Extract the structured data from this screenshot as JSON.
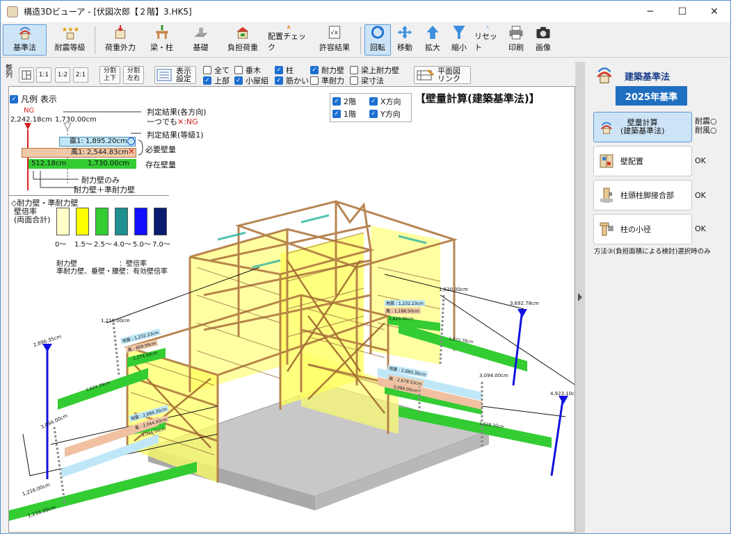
{
  "window": {
    "title": "構造3Dビューア - [伏図次郎【２階】3.HK5]"
  },
  "toolbar": {
    "items": [
      {
        "label": "基準法",
        "icon": "kijunho-icon",
        "active": true
      },
      {
        "label": "耐震等級",
        "icon": "stars-icon"
      },
      {
        "label": "荷重外力",
        "icon": "load-icon"
      },
      {
        "label": "梁・柱",
        "icon": "beam-column-icon"
      },
      {
        "label": "基礎",
        "icon": "foundation-icon"
      },
      {
        "label": "負担荷重",
        "icon": "burden-load-icon"
      },
      {
        "label": "配置チェック",
        "icon": "warning-icon"
      },
      {
        "label": "許容結果",
        "icon": "allowable-result-icon"
      },
      {
        "label": "回転",
        "icon": "rotate-icon",
        "active": true
      },
      {
        "label": "移動",
        "icon": "move-icon"
      },
      {
        "label": "拡大",
        "icon": "zoom-in-icon"
      },
      {
        "label": "縮小",
        "icon": "zoom-out-icon"
      },
      {
        "label": "リセット",
        "icon": "reset-icon"
      },
      {
        "label": "印刷",
        "icon": "print-icon"
      },
      {
        "label": "画像",
        "icon": "camera-icon"
      }
    ]
  },
  "options": {
    "seiretsu": "整列",
    "ratio_1_1": "1:1",
    "ratio_1_2": "1:2",
    "ratio_2_1": "2:1",
    "split_ud": "分割\n上下",
    "split_lr": "分割\n左右",
    "display_settings": "表示\n設定",
    "plan_link": "平面図\nリンク",
    "checks": [
      {
        "label": "全て",
        "checked": false
      },
      {
        "label": "上部",
        "checked": true
      },
      {
        "label": "垂木",
        "checked": false
      },
      {
        "label": "小屋組",
        "checked": true
      },
      {
        "label": "柱",
        "checked": true
      },
      {
        "label": "筋かい",
        "checked": true
      },
      {
        "label": "耐力壁",
        "checked": true
      },
      {
        "label": "準耐力",
        "checked": false
      },
      {
        "label": "梁上耐力壁",
        "checked": false
      },
      {
        "label": "梁寸法",
        "checked": false
      }
    ]
  },
  "view": {
    "legend_checkbox": "凡例 表示",
    "heading": "【壁量計算(建築基準法)】",
    "floors": [
      {
        "label": "2階",
        "checked": true
      },
      {
        "label": "1階",
        "checked": true
      }
    ],
    "directions": [
      {
        "label": "X方向",
        "checked": true
      },
      {
        "label": "Y方向",
        "checked": true
      }
    ],
    "legend": {
      "ng_label": "NG",
      "req_value_left": "2,242.18cm",
      "req_value_right": "1,730.00cm",
      "judge_all": "判定結果(各方向)",
      "judge_all_note": "一つでも",
      "judge_all_mark": "✕:NG",
      "judge_grade": "判定結果(等級1)",
      "quake_bar": "震1: 1,895.20cm",
      "wind_bar": "風1: 2,544.83cm",
      "existing_left": "512.18cm",
      "existing_right": "1,730.00cm",
      "required_wall": "必要壁量",
      "existing_wall": "存在壁量",
      "bearing_only": "耐力壁のみ",
      "bearing_plus": "耐力壁＋準耐力壁",
      "section_title": "◇耐力壁・準耐力壁",
      "ratio_title": "壁倍率\n(両面合計)",
      "swatches": [
        {
          "color": "#ffffc8",
          "label": "0〜"
        },
        {
          "color": "#ffff00",
          "label": "1.5〜"
        },
        {
          "color": "#33cc33",
          "label": "2.5〜"
        },
        {
          "color": "#1f8f8f",
          "label": "4.0〜"
        },
        {
          "color": "#1010ff",
          "label": "5.0〜"
        },
        {
          "color": "#0a1a6e",
          "label": "7.0〜"
        }
      ],
      "note1": "耐力壁　　　　　　：壁倍率",
      "note2": "準耐力壁、垂壁・腰壁：有効壁倍率"
    },
    "dims": [
      "2,896.35cm",
      "1,216.00cm",
      "3,094.00cm",
      "1,216.00cm",
      "1,620.00cm",
      "3,692.78cm",
      "3,094.00cm",
      "4,923.10cm"
    ],
    "bars": [
      {
        "label": "地震 : 1,232.23cm",
        "mark": "circle"
      },
      {
        "label": "風 : 1,188.50cm",
        "mark": "circle"
      },
      {
        "label": "1,620.00cm"
      },
      {
        "label": "1,672.78cm"
      },
      {
        "label": "地震 : 1,232.23cm",
        "mark": "circle"
      },
      {
        "label": "風 : 809.99cm",
        "mark": "circle"
      },
      {
        "label": "1,274.00cm"
      },
      {
        "label": "1,624.39cm"
      },
      {
        "label": "地震 : 2,880.30cm",
        "mark": "circle"
      },
      {
        "label": "風 : 2,678.53cm",
        "mark": "circle"
      },
      {
        "label": "3,094.00cm"
      },
      {
        "label": "1,628.10cm"
      },
      {
        "label": "地震 : 2,886.35cm",
        "mark": "circle"
      },
      {
        "label": "風 : 2,044.00cm",
        "mark": "circle"
      },
      {
        "label": "3,094.00cm"
      },
      {
        "label": "1,216.00cm"
      }
    ]
  },
  "sidebar": {
    "title": "建築基準法",
    "badge": "2025年基準",
    "items": [
      {
        "label": "壁量計算\n(建築基準法)",
        "status": "耐震○\n耐風○",
        "active": true,
        "icon": "wall-calc-icon"
      },
      {
        "label": "壁配置",
        "status": "OK",
        "icon": "wall-layout-icon"
      },
      {
        "label": "柱頭柱脚接合部",
        "status": "OK",
        "icon": "column-joint-icon"
      },
      {
        "label": "柱の小径",
        "status": "OK",
        "icon": "column-diameter-icon"
      }
    ],
    "note": "方法③(負担面積による検討)選択時のみ"
  }
}
